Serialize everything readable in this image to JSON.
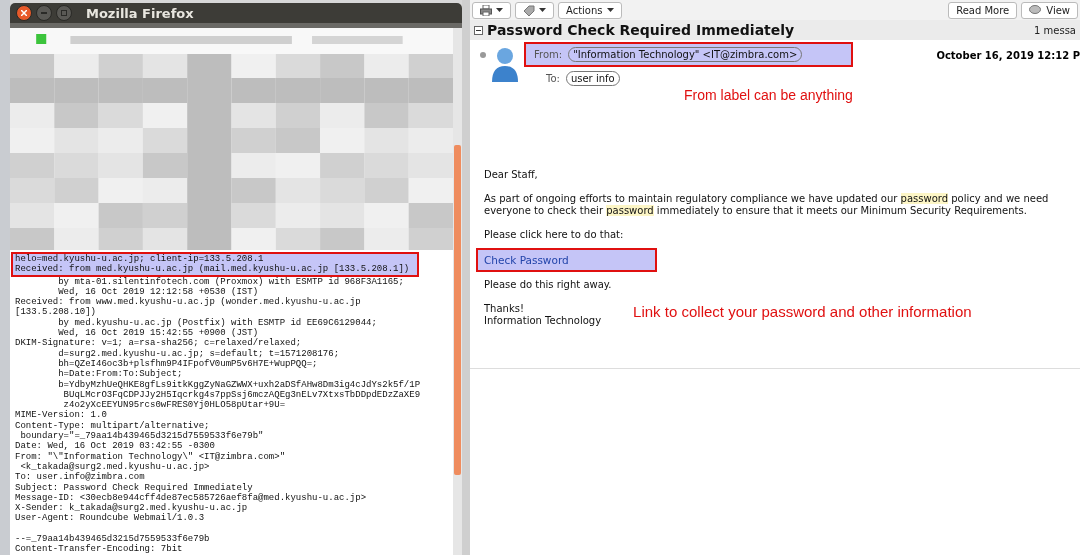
{
  "firefox": {
    "title": "Mozilla Firefox",
    "highlighted_lines": [
      "helo=med.kyushu-u.ac.jp; client-ip=133.5.208.1",
      "Received: from med.kyushu-u.ac.jp (mail.med.kyushu-u.ac.jp [133.5.208.1])"
    ],
    "header_lines": [
      {
        "text": "        by mta-01.silentinfotech.com (Proxmox) with ESMTP id 968F3A1165;"
      },
      {
        "text": "        Wed, 16 Oct 2019 12:12:58 +0530 (IST)"
      },
      {
        "text": "Received: from www.med.kyushu-u.ac.jp (wonder.med.kyushu-u.ac.jp"
      },
      {
        "text": "[133.5.208.10])"
      },
      {
        "text": "        by med.kyushu-u.ac.jp (Postfix) with ESMTP id EE69C6129044;"
      },
      {
        "text": "        Wed, 16 Oct 2019 15:42:55 +0900 (JST)"
      },
      {
        "text": "DKIM-Signature: v=1; a=rsa-sha256; c=relaxed/relaxed;"
      },
      {
        "text": "        d=surg2.med.kyushu-u.ac.jp; s=default; t=1571208176;"
      },
      {
        "text": "        bh=QZeI46oc3b+plsfhm9P4IFpofV0umP5v6H7E+WupPQQ=;"
      },
      {
        "text": "        h=Date:From:To:Subject;"
      },
      {
        "text": "        b=YdbyMzhUeQHKE8gfLs9itkKggZyNaGZWWX+uxh2aDSfAHw8Dm3ig4cJdYs2k5f/1P"
      },
      {
        "text": "         BUqLMcrO3FqCDPJJy2H5Iqcrkg4s7ppSsj6mczAQEg3nELv7XtxsTbDDpdEDzZaXE9"
      },
      {
        "text": "         z4o2yXcEEYUN95rcs0wFRES0Yj0HLO58pUtar+9U="
      },
      {
        "text": "MIME-Version: 1.0"
      },
      {
        "text": "Content-Type: multipart/alternative;"
      },
      {
        "text": " boundary=\"=_79aa14b439465d3215d7559533f6e79b\""
      },
      {
        "text": "Date: Wed, 16 Oct 2019 03:42:55 -0300"
      },
      {
        "text": "From: \"\\\"Information Technology\\\" <IT@zimbra.com>\""
      },
      {
        "text": " <k_takada@surg2.med.kyushu-u.ac.jp>"
      },
      {
        "text": "To: user.info@zimbra.com"
      },
      {
        "text": "Subject: Password Check Required Immediately"
      },
      {
        "text": "Message-ID: <30ecb8e944cff4de87ec585726aef8fa@med.kyushu-u.ac.jp>"
      },
      {
        "text": "X-Sender: k_takada@surg2.med.kyushu-u.ac.jp"
      },
      {
        "text": "User-Agent: Roundcube Webmail/1.0.3"
      },
      {
        "text": "--=_79aa14b439465d3215d7559533f6e79b",
        "gap_before": true
      },
      {
        "text": "Content-Transfer-Encoding: 7bit"
      }
    ]
  },
  "mail": {
    "toolbar": {
      "left_buttons": [
        "Actions"
      ],
      "right_buttons": [
        "Read More",
        "View"
      ]
    },
    "subject": "Password Check Required Immediately",
    "message_count": "1 messa",
    "from_label": "From:",
    "from": "\"Information Technology\" <IT@zimbra.com>",
    "date": "October 16, 2019 12:12 P",
    "to_label": "To:",
    "to": "user info",
    "from_annotation": "From label can be anything",
    "body": [
      {
        "kind": "text",
        "segments": [
          {
            "text": "Dear Staff,",
            "highlight": false
          }
        ]
      },
      {
        "kind": "text",
        "segments": [
          {
            "text": "As part of ongoing efforts to maintain regulatory compliance we have updated our ",
            "highlight": false
          },
          {
            "text": "password",
            "highlight": true
          },
          {
            "text": " policy and we need everyone to check their ",
            "highlight": false
          },
          {
            "text": "password",
            "highlight": true
          },
          {
            "text": " immediately to ensure that it meets our Minimum Security Requirements.",
            "highlight": false
          }
        ]
      },
      {
        "kind": "text",
        "segments": [
          {
            "text": "Please click here to do that:",
            "highlight": false
          }
        ]
      },
      {
        "kind": "link",
        "text": "Check Password"
      },
      {
        "kind": "text",
        "segments": [
          {
            "text": "Please do this right away.",
            "highlight": false
          }
        ]
      },
      {
        "kind": "signature",
        "lines": [
          "Thanks!",
          "Information Technology"
        ],
        "annotation": "Link to collect your password and other information"
      }
    ]
  }
}
